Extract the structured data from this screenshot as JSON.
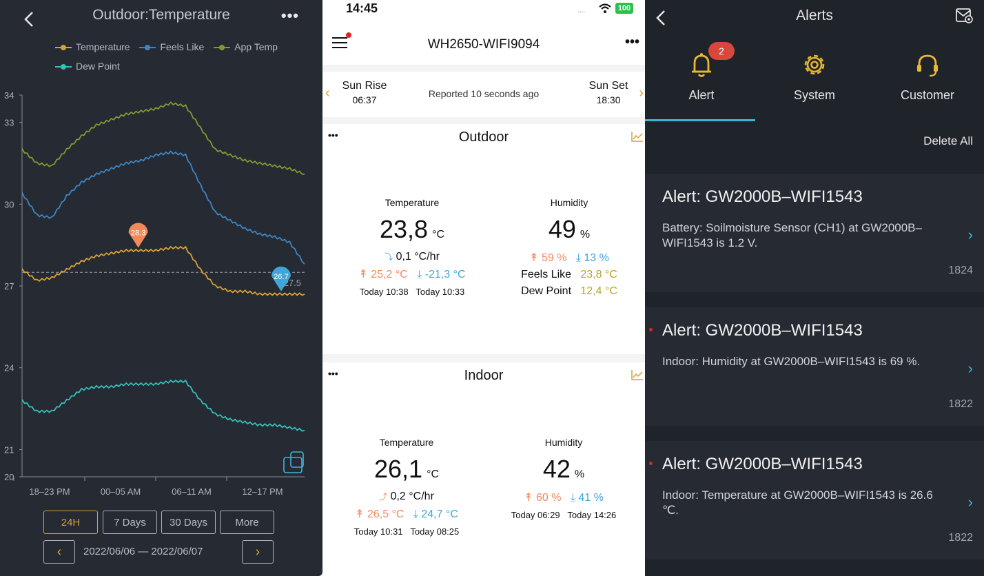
{
  "chart_panel": {
    "title": "Outdoor:Temperature",
    "legend": [
      {
        "label": "Temperature",
        "color": "#d6a332"
      },
      {
        "label": "Feels Like",
        "color": "#3d86c6"
      },
      {
        "label": "App Temp",
        "color": "#7f9a33"
      },
      {
        "label": "Dew Point",
        "color": "#33c0b8"
      }
    ],
    "ranges": [
      "24H",
      "7 Days",
      "30 Days",
      "More"
    ],
    "active_range": "24H",
    "date_range": "2022/06/06 — 2022/06/07",
    "colors": {
      "background": "#262a33",
      "accent": "#d6a332"
    }
  },
  "chart_data": {
    "type": "line",
    "x_tick_labels": [
      "18–23 PM",
      "00–05 AM",
      "06–11 AM",
      "12–17 PM"
    ],
    "y_tick_labels": [
      "34",
      "33",
      "30",
      "27",
      "24",
      "21",
      "20"
    ],
    "ylim": [
      20,
      34
    ],
    "reference_line": {
      "y": 27.5,
      "label": "27.5"
    },
    "markers": [
      {
        "label": "28.3",
        "series": "Temperature",
        "color": "#f08a5d"
      },
      {
        "label": "26.7",
        "series": "Temperature",
        "color": "#3ea6db"
      }
    ],
    "series": [
      {
        "name": "App Temp",
        "color": "#7f9a33",
        "values": [
          32.0,
          31.5,
          31.4,
          32.0,
          32.5,
          32.9,
          33.1,
          33.3,
          33.4,
          33.5,
          33.7,
          33.6,
          32.8,
          32.0,
          31.8,
          31.6,
          31.5,
          31.4,
          31.3,
          31.1
        ]
      },
      {
        "name": "Feels Like",
        "color": "#3d86c6",
        "values": [
          30.4,
          29.6,
          29.5,
          30.3,
          30.8,
          31.1,
          31.3,
          31.5,
          31.6,
          31.8,
          31.9,
          31.8,
          30.7,
          29.7,
          29.4,
          29.1,
          28.9,
          28.8,
          28.6,
          27.8
        ]
      },
      {
        "name": "Temperature",
        "color": "#d6a332",
        "values": [
          27.6,
          27.2,
          27.3,
          27.6,
          27.9,
          28.1,
          28.2,
          28.3,
          28.3,
          28.3,
          28.4,
          28.4,
          27.6,
          27.0,
          26.8,
          26.8,
          26.7,
          26.7,
          26.7,
          26.7
        ]
      },
      {
        "name": "Dew Point",
        "color": "#33c0b8",
        "values": [
          22.8,
          22.4,
          22.4,
          22.8,
          23.2,
          23.3,
          23.3,
          23.4,
          23.4,
          23.4,
          23.5,
          23.5,
          22.8,
          22.3,
          22.1,
          22.0,
          21.9,
          21.9,
          21.8,
          21.7
        ]
      }
    ]
  },
  "dashboard": {
    "status": {
      "time": "14:45",
      "signal": "....",
      "battery": "100"
    },
    "device_name": "WH2650-WIFI9094",
    "nav_more": "•••",
    "sun": {
      "rise_label": "Sun Rise",
      "rise_time": "06:37",
      "reported": "Reported 10 seconds ago",
      "set_label": "Sun Set",
      "set_time": "18:30"
    },
    "outdoor": {
      "title": "Outdoor",
      "dots": "•••",
      "temp_label": "Temperature",
      "temp_value": "23,8",
      "temp_unit": "°C",
      "rate": "0,1 °C/hr",
      "temp_high": "↟ 25,2 °C",
      "temp_low": "⤓ -21,3 °C",
      "temp_high_time": "Today 10:38",
      "temp_low_time": "Today 10:33",
      "hum_label": "Humidity",
      "hum_value": "49",
      "hum_unit": "%",
      "hum_high": "↟ 59 %",
      "hum_low": "⤓ 13 %",
      "feels_label": "Feels Like",
      "feels_value": "23,8 °C",
      "dew_label": "Dew Point",
      "dew_value": "12,4 °C"
    },
    "indoor": {
      "title": "Indoor",
      "dots": "•••",
      "temp_label": "Temperature",
      "temp_value": "26,1",
      "temp_unit": "°C",
      "rate": "0,2 °C/hr",
      "temp_high": "↟ 26,5 °C",
      "temp_low": "⤓ 24,7 °C",
      "temp_high_time": "Today 10:31",
      "temp_low_time": "Today 08:25",
      "hum_label": "Humidity",
      "hum_value": "42",
      "hum_unit": "%",
      "hum_high": "↟ 60 %",
      "hum_low": "⤓ 41 %",
      "hum_high_time": "Today 06:29",
      "hum_low_time": "Today 14:26"
    }
  },
  "alerts_panel": {
    "title": "Alerts",
    "tabs": [
      {
        "label": "Alert",
        "icon": "bell-icon",
        "badge": "2"
      },
      {
        "label": "System",
        "icon": "gear-icon"
      },
      {
        "label": "Customer",
        "icon": "headset-icon"
      }
    ],
    "delete_all": "Delete All",
    "alerts": [
      {
        "title": "Alert: GW2000B–WIFI1543",
        "body": "Battery: Soilmoisture Sensor (CH1) at GW2000B–WIFI1543 is 1.2 V.",
        "id": "1824",
        "unread": false
      },
      {
        "title": "Alert: GW2000B–WIFI1543",
        "body": "Indoor: Humidity at GW2000B–WIFI1543 is 69 %.",
        "id": "1822",
        "unread": true
      },
      {
        "title": "Alert: GW2000B–WIFI1543",
        "body": "Indoor: Temperature at GW2000B–WIFI1543 is 26.6 ℃.",
        "id": "1822",
        "unread": true
      }
    ],
    "colors": {
      "background": "#1f232a",
      "card": "#262a33",
      "accent": "#3bb7d6",
      "badge": "#d9463b"
    }
  }
}
